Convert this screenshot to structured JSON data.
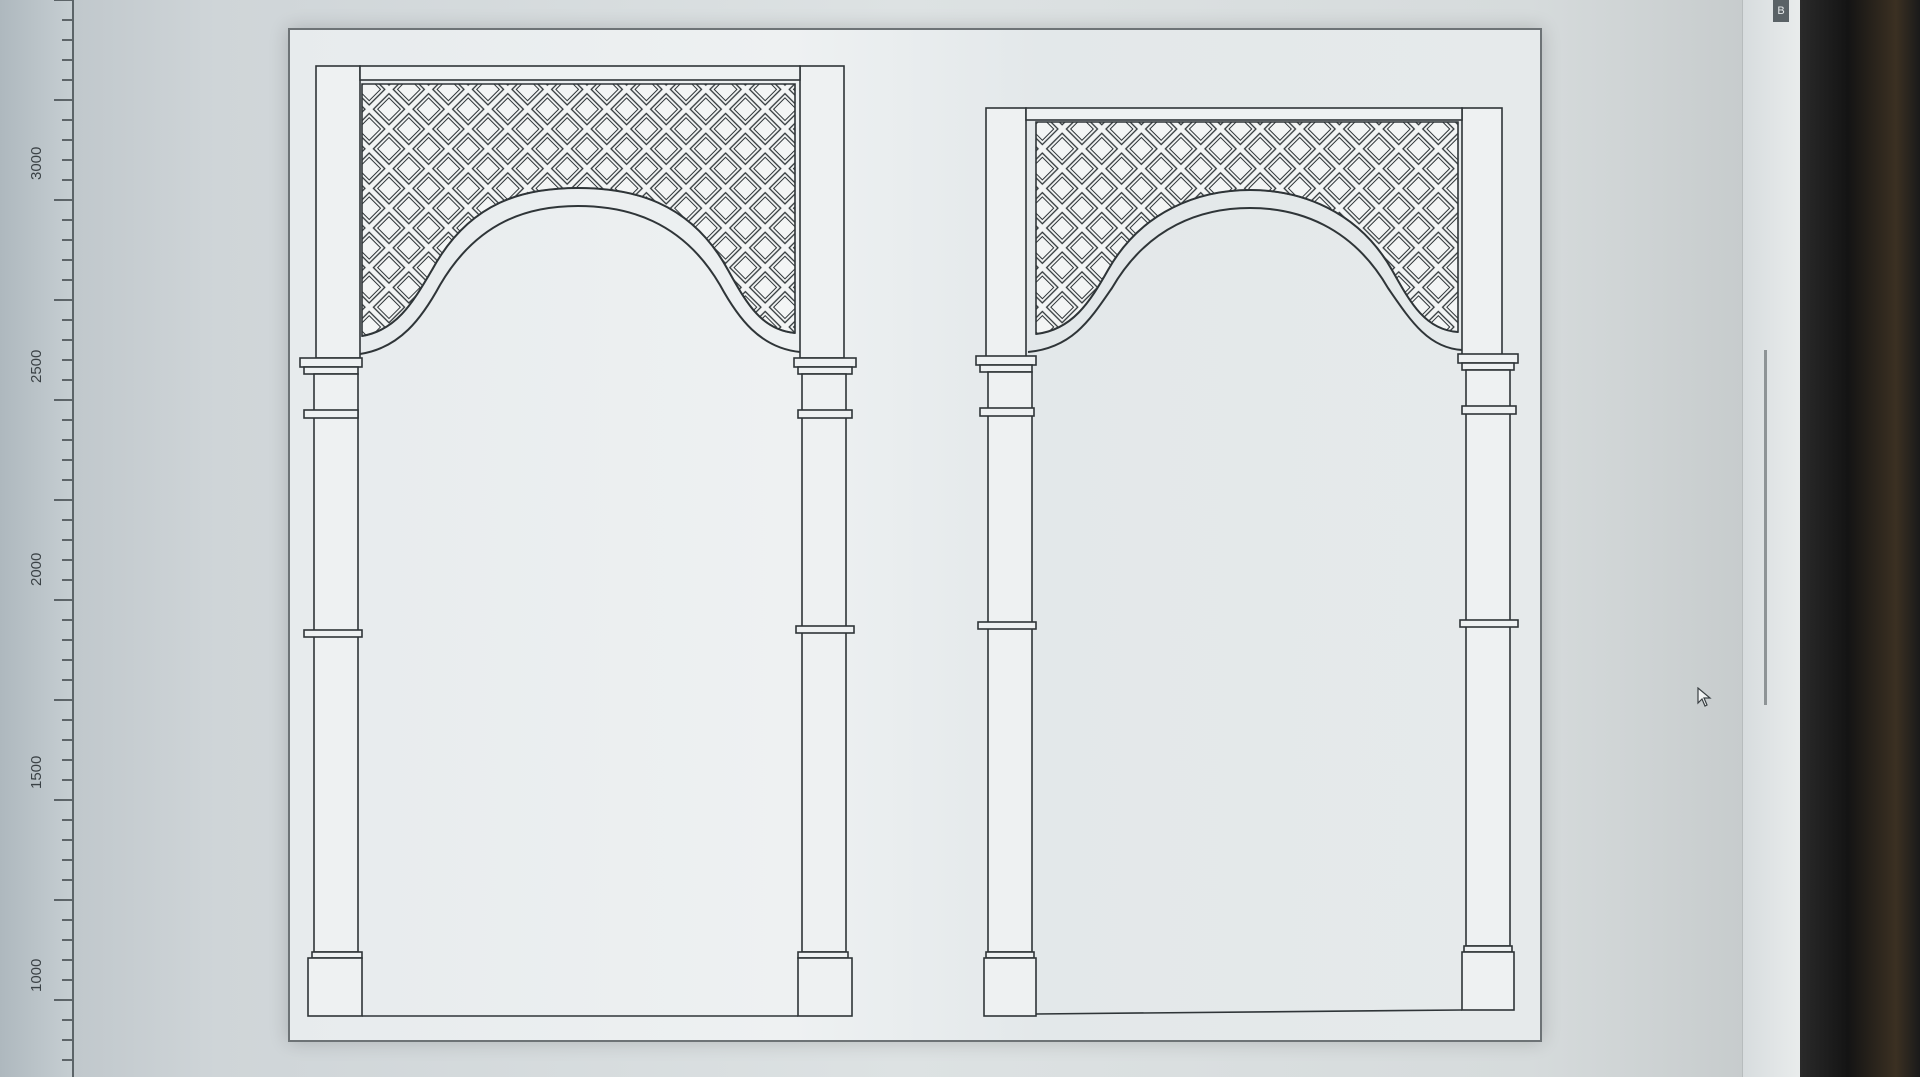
{
  "ruler": {
    "labels": [
      "3000",
      "2500",
      "2000",
      "1500",
      "1000"
    ]
  },
  "scrollbar": {
    "corner_label": "B"
  },
  "icons": {
    "cursor": "arrow-cursor-icon"
  },
  "colors": {
    "line": "#2f3538",
    "paper": "#eceff0",
    "ruler": "#b9c2c7"
  }
}
